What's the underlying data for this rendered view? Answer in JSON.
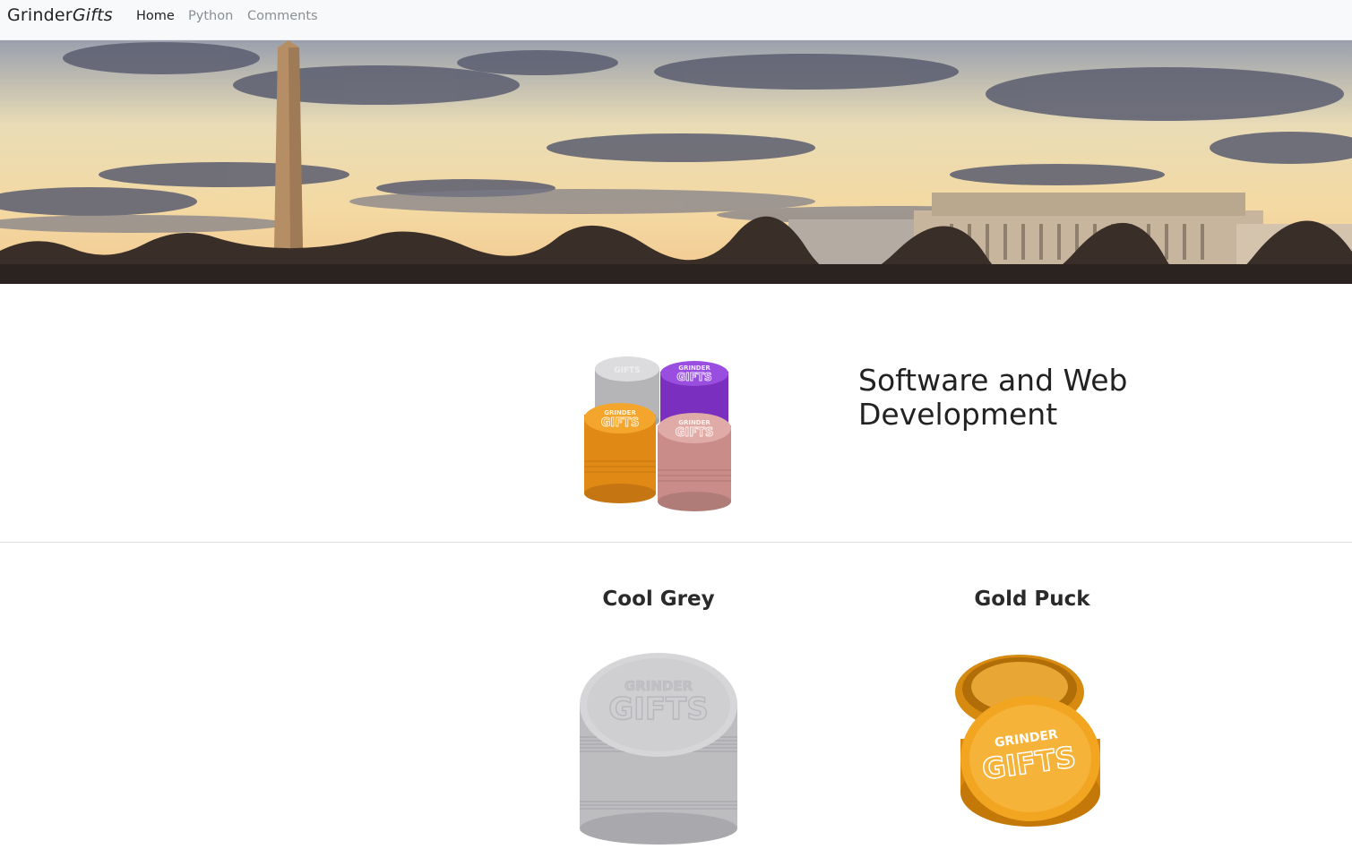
{
  "navbar": {
    "brand_regular": "Grinder",
    "brand_italic": "Gifts",
    "links": [
      {
        "label": "Home",
        "active": true
      },
      {
        "label": "Python",
        "active": false
      },
      {
        "label": "Comments",
        "active": false
      }
    ]
  },
  "feature": {
    "title": "Software and Web Development",
    "image_lettering": [
      "GRINDER",
      "GIFTS"
    ]
  },
  "products": [
    {
      "name": "Cool Grey",
      "color": "#c9c9cb"
    },
    {
      "name": "Gold Puck",
      "color": "#f0a524"
    }
  ],
  "colors": {
    "navbar_bg": "#f8f9fa",
    "text": "#212529",
    "muted_link": "#8a8f94",
    "grinder_silver": "#c8c8ca",
    "grinder_purple": "#8a3fd0",
    "grinder_orange": "#e89520",
    "grinder_pink": "#d59c98"
  }
}
